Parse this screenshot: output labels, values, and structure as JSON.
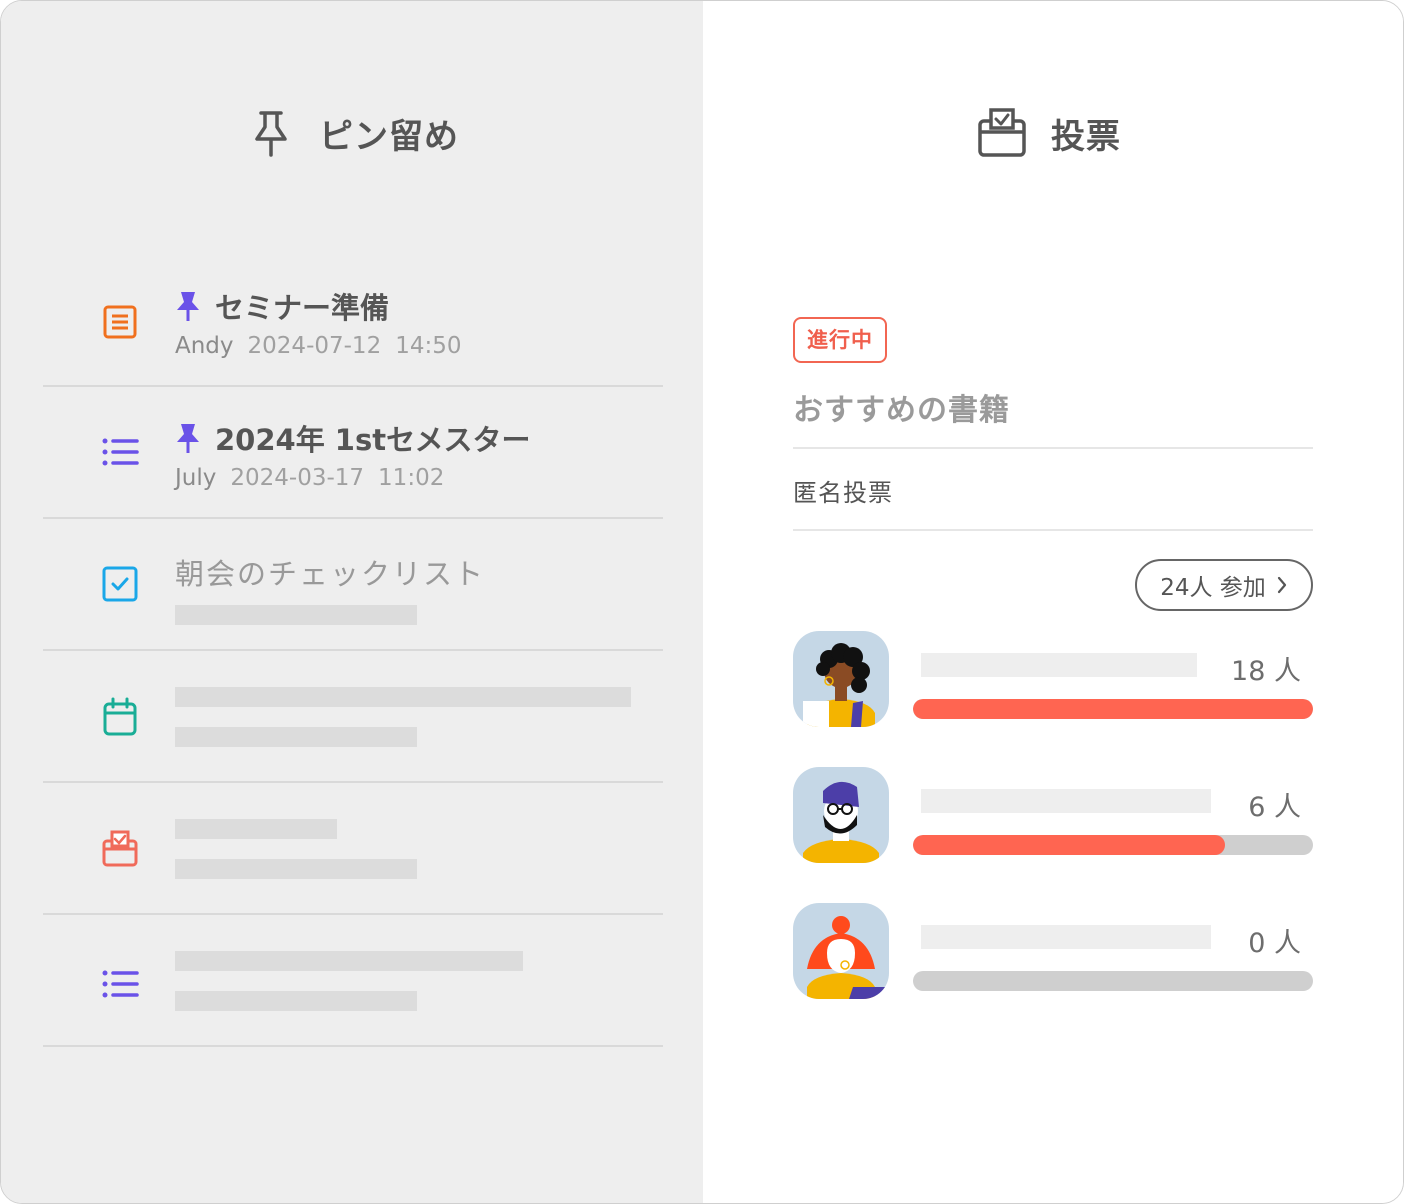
{
  "pins": {
    "heading": "ピン留め",
    "icon": "pushpin-icon",
    "items": [
      {
        "icon": "note-icon",
        "color": "#f0701e",
        "pinned": true,
        "title": "セミナー準備",
        "author": "Andy",
        "date": "2024-07-12",
        "time": "14:50"
      },
      {
        "icon": "list-icon",
        "color": "#6a52e8",
        "pinned": true,
        "title": "2024年 1stセメスター",
        "author": "July",
        "date": "2024-03-17",
        "time": "11:02"
      },
      {
        "icon": "checkbox-icon",
        "color": "#1aa7e8",
        "pinned": false,
        "title": "朝会のチェックリスト"
      },
      {
        "icon": "calendar-icon",
        "color": "#19ad96",
        "pinned": false
      },
      {
        "icon": "ballot-box-icon",
        "color": "#f06a5a",
        "pinned": false
      },
      {
        "icon": "list-icon",
        "color": "#6a52e8",
        "pinned": false
      }
    ]
  },
  "poll": {
    "heading": "投票",
    "icon": "ballot-box-icon",
    "status": "進行中",
    "title": "おすすめの書籍",
    "mode": "匿名投票",
    "participants": "24人 参加",
    "total": 24,
    "options": [
      {
        "votes": 18,
        "count_label": "18 人",
        "fill_fraction": 1.0
      },
      {
        "votes": 6,
        "count_label": "6 人",
        "fill_fraction": 0.78
      },
      {
        "votes": 0,
        "count_label": "0 人",
        "fill_fraction": 0
      }
    ]
  },
  "colors": {
    "accent": "#f26652",
    "pin": "#6a52e8",
    "panel": "#eeeeee"
  }
}
